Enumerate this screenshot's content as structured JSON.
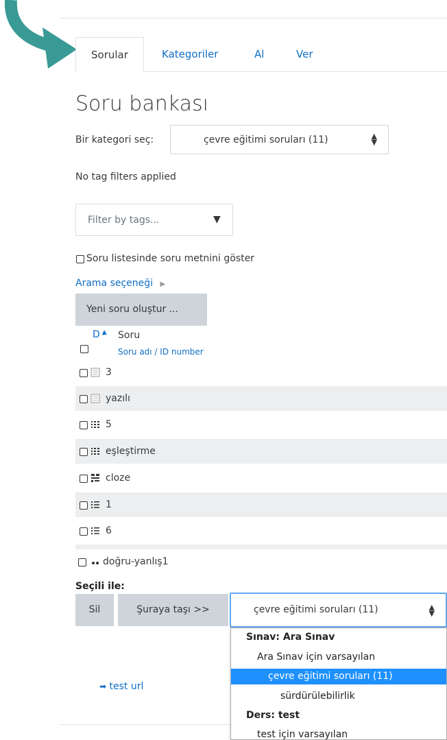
{
  "tabs": [
    {
      "label": "Sorular",
      "active": true
    },
    {
      "label": "Kategoriler",
      "active": false
    },
    {
      "label": "Al",
      "active": false
    },
    {
      "label": "Ver",
      "active": false
    }
  ],
  "page_title": "Soru bankası",
  "category_select": {
    "label": "Bir kategori seç:",
    "value": "çevre eğitimi soruları (11)"
  },
  "tag_filter_status": "No tag filters applied",
  "tag_filter": {
    "placeholder": "Filter by tags..."
  },
  "show_text_checkbox_label": "Soru listesinde soru metnini göster",
  "search_options_label": "Arama seçeneği",
  "create_button": "Yeni soru oluştur ...",
  "table": {
    "col_type": "D",
    "col_question": "Soru",
    "col_sub": "Soru adı / ID number",
    "rows": [
      {
        "name": "3",
        "icon": "essay-icon"
      },
      {
        "name": "yazılı",
        "icon": "essay-icon"
      },
      {
        "name": "5",
        "icon": "matching-icon"
      },
      {
        "name": "eşleştirme",
        "icon": "matching-icon"
      },
      {
        "name": "cloze",
        "icon": "cloze-icon"
      },
      {
        "name": "1",
        "icon": "multichoice-icon"
      },
      {
        "name": "6",
        "icon": "multichoice-icon"
      },
      {
        "name": "doğru-yanlış1",
        "icon": "truefalse-icon"
      }
    ]
  },
  "with_selected": {
    "label": "Seçili ile:",
    "delete_button": "Sil",
    "move_button": "Şuraya taşı >>",
    "move_select_value": "çevre eğitimi soruları (11)"
  },
  "dropdown": {
    "options": [
      {
        "text": "Sınav: Ara Sınav",
        "type": "group"
      },
      {
        "text": "Ara Sınav için varsayılan",
        "type": "option",
        "level": 1
      },
      {
        "text": "çevre eğitimi soruları (11)",
        "type": "selected",
        "level": 2
      },
      {
        "text": "sürdürülebilirlik",
        "type": "option",
        "level": 2
      },
      {
        "text": "Ders: test",
        "type": "group"
      },
      {
        "text": "test için varsayılan",
        "type": "option",
        "level": 1
      }
    ]
  },
  "test_url_link": "test url",
  "colors": {
    "accent": "#0f6fc5",
    "arrow": "#3a9a95",
    "selected": "#1e90ff"
  }
}
